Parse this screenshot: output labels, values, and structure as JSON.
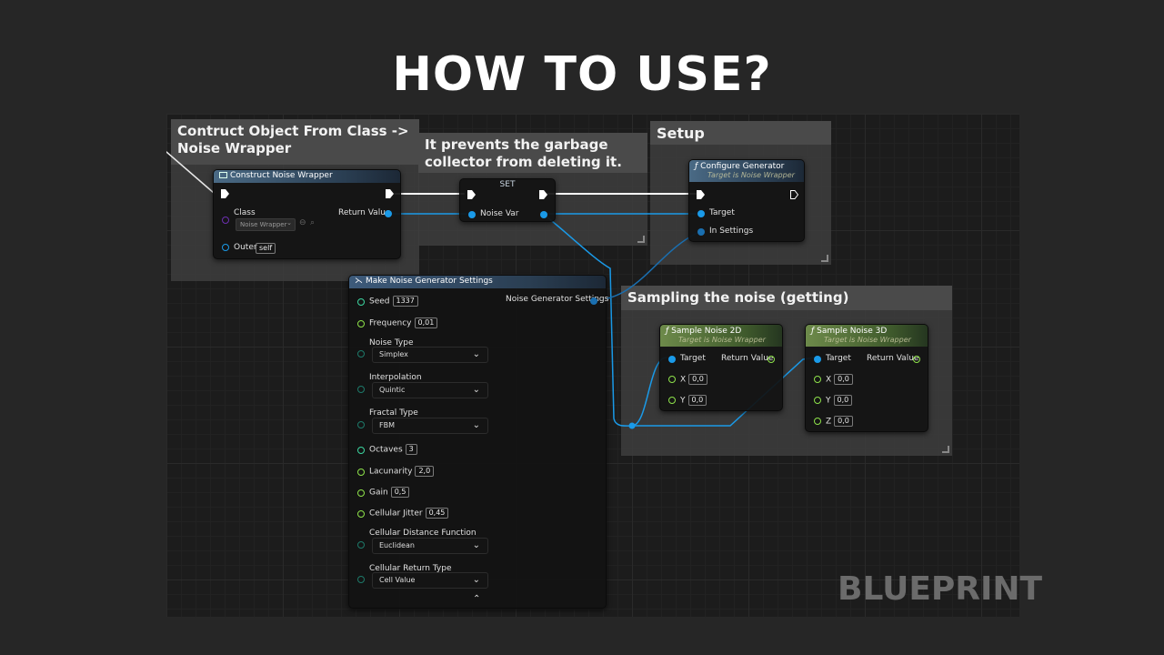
{
  "title": "HOW TO USE?",
  "watermark": "BLUEPRINT",
  "comments": {
    "construct": "Contruct Object From Class -> Noise Wrapper",
    "garbage": "It prevents the garbage collector from deleting it.",
    "setup": "Setup",
    "sampling": "Sampling the noise (getting)"
  },
  "construct_node": {
    "title": "Construct Noise Wrapper",
    "class_label": "Class",
    "class_value": "Noise Wrapper",
    "return_label": "Return Value",
    "outer_label": "Outer",
    "outer_value": "self"
  },
  "set_node": {
    "title": "SET",
    "var_label": "Noise Var"
  },
  "configure_node": {
    "title": "Configure Generator",
    "subtitle": "Target is Noise Wrapper",
    "target_label": "Target",
    "settings_label": "In Settings"
  },
  "make_node": {
    "title": "Make Noise Generator Settings",
    "output_label": "Noise Generator Settings",
    "seed_label": "Seed",
    "seed_value": "1337",
    "frequency_label": "Frequency",
    "frequency_value": "0,01",
    "noise_type_label": "Noise Type",
    "noise_type_value": "Simplex",
    "interpolation_label": "Interpolation",
    "interpolation_value": "Quintic",
    "fractal_label": "Fractal Type",
    "fractal_value": "FBM",
    "octaves_label": "Octaves",
    "octaves_value": "3",
    "lacunarity_label": "Lacunarity",
    "lacunarity_value": "2,0",
    "gain_label": "Gain",
    "gain_value": "0,5",
    "jitter_label": "Cellular Jitter",
    "jitter_value": "0,45",
    "distance_label": "Cellular Distance Function",
    "distance_value": "Euclidean",
    "return_type_label": "Cellular Return Type",
    "return_type_value": "Cell Value"
  },
  "sample2d_node": {
    "title": "Sample Noise 2D",
    "subtitle": "Target is Noise Wrapper",
    "target_label": "Target",
    "return_label": "Return Value",
    "x_label": "X",
    "x_value": "0,0",
    "y_label": "Y",
    "y_value": "0,0"
  },
  "sample3d_node": {
    "title": "Sample Noise 3D",
    "subtitle": "Target is Noise Wrapper",
    "target_label": "Target",
    "return_label": "Return Value",
    "x_label": "X",
    "x_value": "0,0",
    "y_label": "Y",
    "y_value": "0,0",
    "z_label": "Z",
    "z_value": "0,0"
  },
  "colors": {
    "object_pin": "#1a9ae8",
    "float_pin": "#8ee24a",
    "int_pin": "#3cd6a0",
    "enum_pin": "#1d7a6a",
    "class_pin": "#6c2fb0",
    "exec": "#ffffff"
  }
}
